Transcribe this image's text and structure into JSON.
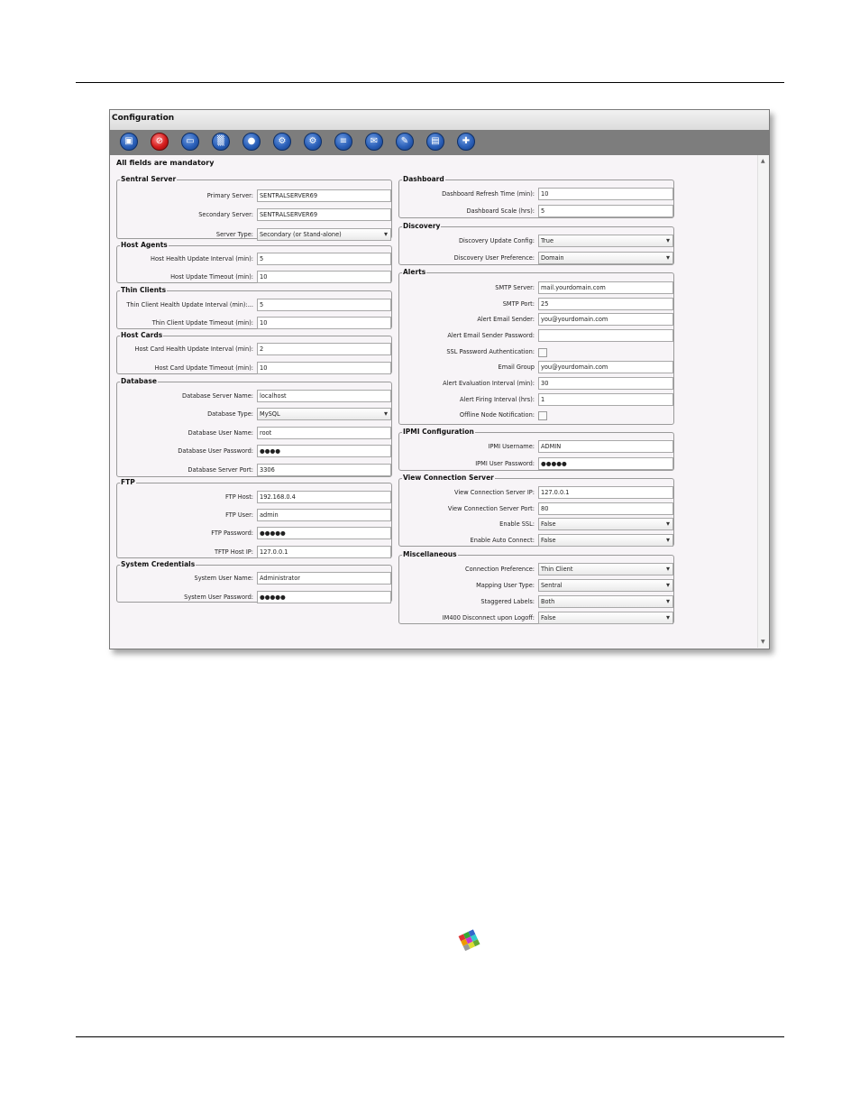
{
  "window": {
    "title": "Configuration",
    "mandatory_note": "All fields are mandatory"
  },
  "toolbar": {
    "buttons": [
      {
        "name": "save-icon",
        "glyph": "▣"
      },
      {
        "name": "cancel-icon",
        "glyph": "⊘"
      },
      {
        "name": "window-icon",
        "glyph": "▭"
      },
      {
        "name": "color-grid-icon",
        "glyph": "▒"
      },
      {
        "name": "users-icon",
        "glyph": "●"
      },
      {
        "name": "gear-icon",
        "glyph": "⚙"
      },
      {
        "name": "gear-alt-icon",
        "glyph": "⚙"
      },
      {
        "name": "database-icon",
        "glyph": "≡"
      },
      {
        "name": "email-icon",
        "glyph": "✉"
      },
      {
        "name": "tools-icon",
        "glyph": "✎"
      },
      {
        "name": "lock-icon",
        "glyph": "▤"
      },
      {
        "name": "add-user-icon",
        "glyph": "✚"
      }
    ]
  },
  "left": {
    "sentral_server": {
      "title": "Sentral Server",
      "fields": [
        {
          "label": "Primary Server:",
          "value": "SENTRALSERVER69",
          "type": "text"
        },
        {
          "label": "Secondary Server:",
          "value": "SENTRALSERVER69",
          "type": "text"
        },
        {
          "label": "Server Type:",
          "value": "Secondary (or Stand-alone)",
          "type": "select"
        }
      ]
    },
    "host_agents": {
      "title": "Host Agents",
      "fields": [
        {
          "label": "Host Health Update Interval (min):",
          "value": "5",
          "type": "text"
        },
        {
          "label": "Host Update Timeout (min):",
          "value": "10",
          "type": "text"
        }
      ]
    },
    "thin_clients": {
      "title": "Thin Clients",
      "fields": [
        {
          "label": "Thin Client Health Update Interval (min):...",
          "value": "5",
          "type": "text"
        },
        {
          "label": "Thin Client Update Timeout (min):",
          "value": "10",
          "type": "text"
        }
      ]
    },
    "host_cards": {
      "title": "Host Cards",
      "fields": [
        {
          "label": "Host Card Health Update Interval (min):",
          "value": "2",
          "type": "text"
        },
        {
          "label": "Host Card Update Timeout (min):",
          "value": "10",
          "type": "text"
        }
      ]
    },
    "database": {
      "title": "Database",
      "fields": [
        {
          "label": "Database Server Name:",
          "value": "localhost",
          "type": "text"
        },
        {
          "label": "Database Type:",
          "value": "MySQL",
          "type": "select"
        },
        {
          "label": "Database User Name:",
          "value": "root",
          "type": "text"
        },
        {
          "label": "Database User Password:",
          "value": "●●●●",
          "type": "password"
        },
        {
          "label": "Database Server Port:",
          "value": "3306",
          "type": "text"
        }
      ]
    },
    "ftp": {
      "title": "FTP",
      "fields": [
        {
          "label": "FTP Host:",
          "value": "192.168.0.4",
          "type": "text"
        },
        {
          "label": "FTP User:",
          "value": "admin",
          "type": "text"
        },
        {
          "label": "FTP Password:",
          "value": "●●●●●",
          "type": "password"
        },
        {
          "label": "TFTP Host IP:",
          "value": "127.0.0.1",
          "type": "text"
        }
      ]
    },
    "system_credentials": {
      "title": "System Credentials",
      "fields": [
        {
          "label": "System User Name:",
          "value": "Administrator",
          "type": "text"
        },
        {
          "label": "System User Password:",
          "value": "●●●●●",
          "type": "password"
        }
      ]
    }
  },
  "right": {
    "dashboard": {
      "title": "Dashboard",
      "fields": [
        {
          "label": "Dashboard Refresh Time (min):",
          "value": "10",
          "type": "text"
        },
        {
          "label": "Dashboard Scale (hrs):",
          "value": "5",
          "type": "text"
        }
      ]
    },
    "discovery": {
      "title": "Discovery",
      "fields": [
        {
          "label": "Discovery Update Config:",
          "value": "True",
          "type": "select"
        },
        {
          "label": "Discovery User Preference:",
          "value": "Domain",
          "type": "select"
        }
      ]
    },
    "alerts": {
      "title": "Alerts",
      "fields": [
        {
          "label": "SMTP Server:",
          "value": "mail.yourdomain.com",
          "type": "text"
        },
        {
          "label": "SMTP Port:",
          "value": "25",
          "type": "text"
        },
        {
          "label": "Alert Email Sender:",
          "value": "you@yourdomain.com",
          "type": "text"
        },
        {
          "label": "Alert Email Sender Password:",
          "value": "",
          "type": "password"
        },
        {
          "label": "SSL Password Authentication:",
          "value": "",
          "type": "checkbox"
        },
        {
          "label": "Email Group",
          "value": "you@yourdomain.com",
          "type": "text"
        },
        {
          "label": "Alert Evaluation Interval (min):",
          "value": "30",
          "type": "text"
        },
        {
          "label": "Alert Firing Interval (hrs):",
          "value": "1",
          "type": "text"
        },
        {
          "label": "Offline Node Notification:",
          "value": "",
          "type": "checkbox"
        }
      ]
    },
    "ipmi": {
      "title": "IPMI Configuration",
      "fields": [
        {
          "label": "IPMI Username:",
          "value": "ADMIN",
          "type": "text"
        },
        {
          "label": "IPMI User Password:",
          "value": "●●●●●",
          "type": "password"
        }
      ]
    },
    "view_connection_server": {
      "title": "View Connection Server",
      "fields": [
        {
          "label": "View Connection Server IP:",
          "value": "127.0.0.1",
          "type": "text"
        },
        {
          "label": "View Connection Server Port:",
          "value": "80",
          "type": "text"
        },
        {
          "label": "Enable SSL:",
          "value": "False",
          "type": "select"
        },
        {
          "label": "Enable Auto Connect:",
          "value": "False",
          "type": "select"
        }
      ]
    },
    "miscellaneous": {
      "title": "Miscellaneous",
      "fields": [
        {
          "label": "Connection Preference:",
          "value": "Thin Client",
          "type": "select"
        },
        {
          "label": "Mapping User Type:",
          "value": "Sentral",
          "type": "select"
        },
        {
          "label": "Staggered Labels:",
          "value": "Both",
          "type": "select"
        },
        {
          "label": "IM400 Disconnect upon Logoff:",
          "value": "False",
          "type": "select"
        }
      ]
    }
  }
}
